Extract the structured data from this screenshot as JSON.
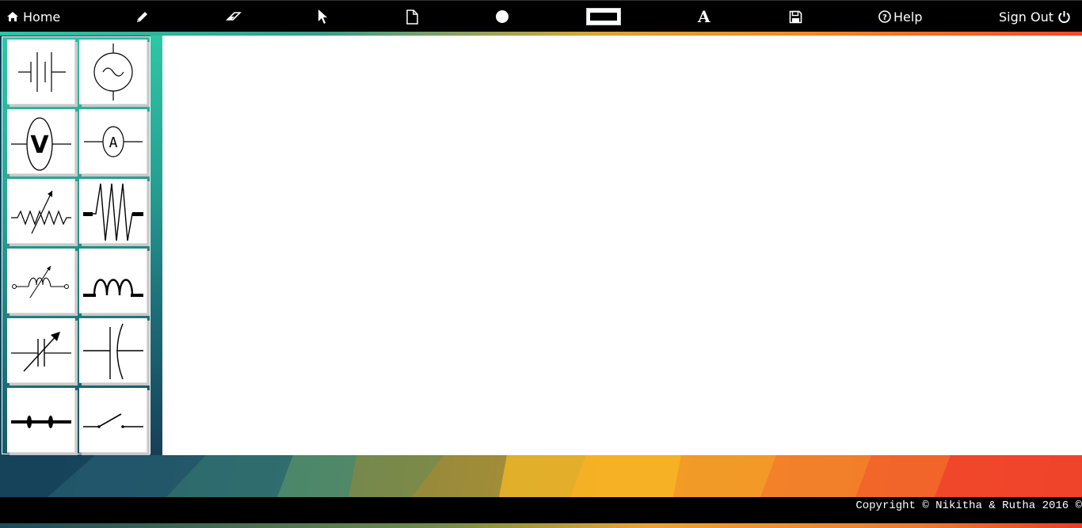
{
  "nav": {
    "home_label": "Home",
    "help_label": "Help",
    "signout_label": "Sign Out",
    "text_tool_glyph": "A",
    "tools": [
      "pencil-icon",
      "eraser-icon",
      "pointer-icon",
      "new-page-icon",
      "circle-icon",
      "rectangle-icon",
      "text-icon",
      "save-icon"
    ]
  },
  "components": [
    "battery",
    "ac-source",
    "voltmeter",
    "ammeter",
    "rheostat",
    "resistor",
    "variable-inductor",
    "inductor",
    "variable-capacitor",
    "capacitor",
    "fuse",
    "switch"
  ],
  "voltmeter_letter": "V",
  "ammeter_letter": "A",
  "footer": {
    "copyright": "Copyright © Nikitha & Rutha 2016 ©"
  },
  "colors": {
    "topbar": "#000000",
    "canvas": "#ffffff",
    "sidebar_accent": "#2fc6a6"
  }
}
